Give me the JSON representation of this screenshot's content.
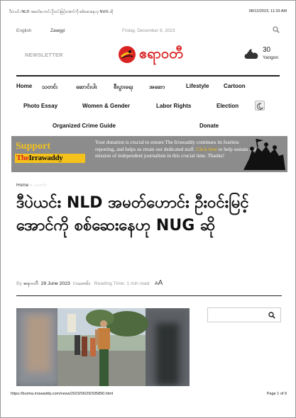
{
  "print_header": {
    "title": "ဒီပဲယင်း NLD အမတ်ဟောင်း ဦးဝင်းမြင့်အောင်ကို စစ်ဆေးနေဟု NUG ဆို",
    "datetime": "08/12/2023, 11:33 AM"
  },
  "topbar": {
    "lang_english": "English",
    "lang_zawgyi": "Zawgyi",
    "date": "Friday, December 8, 2023",
    "search_icon": "search-icon"
  },
  "header": {
    "newsletter": "NEWSLETTER",
    "logo_text": "ဧရာဝတီ",
    "weather": {
      "temp": "30",
      "location": "Yangon",
      "icon": "cloud-moon-icon"
    }
  },
  "nav": {
    "row1": [
      "Home",
      "သတင်း",
      "ဆောင်းပါး",
      "စီးပွားရေး",
      "အဆော",
      "Lifestyle",
      "Cartoon"
    ],
    "row2": [
      "Photo Essay",
      "Women & Gender",
      "Labor Rights",
      "Election"
    ],
    "row3": [
      "Organized Crime Guide",
      "Donate"
    ],
    "dark_mode_icon": "moon-icon"
  },
  "banner": {
    "support": "Support",
    "the": "The",
    "irrawaddy": "Irrawaddy",
    "msg_before": "Your donation is crucial to ensure The Irrawaddy continues its fearless reporting, and helps us retain our dedicated staff. ",
    "click_here": "Click here",
    "msg_after": " to help sustain our mission of independent journalism in this crucial time. Thanks!"
  },
  "breadcrumb": {
    "home": "Home",
    "sep": "»",
    "current": "သတင်း"
  },
  "article": {
    "headline": "ဒီပဲယင်း NLD အမတ်ဟောင်း ဦးဝင်းမြင့်အောင်ကို စစ်ဆေးနေဟု NUG ဆို",
    "by": "By",
    "author": "ဧရာဝတီ",
    "date": "29 June 2023",
    "in": "In",
    "category": "သတင်း",
    "reading_time": "Reading Time: 1 min read",
    "font_size_small": "A",
    "font_size_large": "A"
  },
  "print_footer": {
    "url": "https://burma.irrawaddy.com/news/2023/06/29/335890.html",
    "page": "Page 1 of 9"
  }
}
